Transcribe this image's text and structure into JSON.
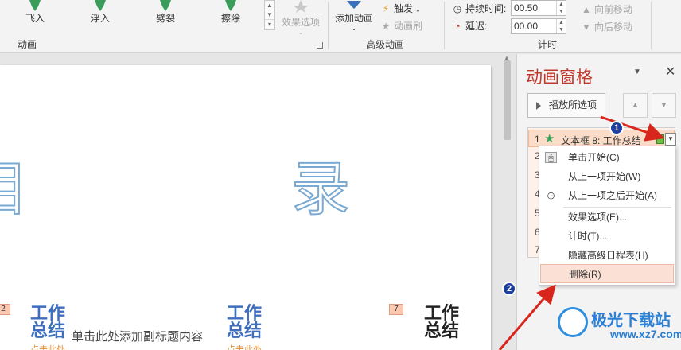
{
  "ribbon": {
    "effects": [
      "飞入",
      "浮入",
      "劈裂",
      "擦除"
    ],
    "effect_options_label": "效果选项",
    "add_animation_label": "添加动画",
    "trigger_label": "触发",
    "animation_painter_label": "动画刷",
    "group_animation": "动画",
    "group_advanced": "高级动画",
    "group_timing": "计时",
    "duration_label": "持续时间:",
    "duration_value": "00.50",
    "delay_label": "延迟:",
    "delay_value": "00.00",
    "move_earlier": "向前移动",
    "move_later": "向后移动"
  },
  "slide": {
    "big_chars": [
      "目",
      "录"
    ],
    "tags": [
      "2",
      "7"
    ],
    "work_title_line1": "工作",
    "work_title_line2": "总结",
    "subtitle_placeholder": "单击此处添加副标题内容",
    "click_here": "点击此处"
  },
  "pane": {
    "title": "动画窗格",
    "play_selected": "播放所选项",
    "item_number": "1",
    "item_text": "文本框 8: 工作总结",
    "list_numbers": [
      "2",
      "3",
      "4",
      "5",
      "6",
      "7"
    ]
  },
  "context_menu": {
    "items": [
      "单击开始(C)",
      "从上一项开始(W)",
      "从上一项之后开始(A)",
      "效果选项(E)...",
      "计时(T)...",
      "隐藏高级日程表(H)",
      "删除(R)"
    ]
  },
  "callouts": [
    "1",
    "2"
  ],
  "watermark": {
    "brand": "极光下载站",
    "site": "www.xz7.com"
  }
}
